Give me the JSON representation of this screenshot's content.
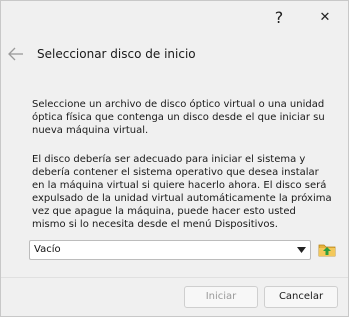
{
  "window": {
    "help_glyph": "?",
    "close_glyph": "✕"
  },
  "header": {
    "title": "Seleccionar disco de inicio"
  },
  "body": {
    "paragraph1": "Seleccione un archivo de disco óptico virtual o una unidad óptica física que contenga un disco desde el que iniciar su nueva máquina virtual.",
    "paragraph2": "El disco debería ser adecuado para iniciar el sistema y debería contener el sistema operativo que desea instalar en la máquina virtual si quiere hacerlo ahora. El disco será expulsado de la unidad virtual automáticamente la próxima vez que apague la máquina, puede hacer esto usted mismo si lo necesita desde el menú Dispositivos."
  },
  "disk_select": {
    "value": "Vacío"
  },
  "buttons": {
    "start_label": "Iniciar",
    "cancel_label": "Cancelar"
  },
  "colors": {
    "folder": "#e8b23c",
    "folder_arrow": "#2e9e3e"
  }
}
